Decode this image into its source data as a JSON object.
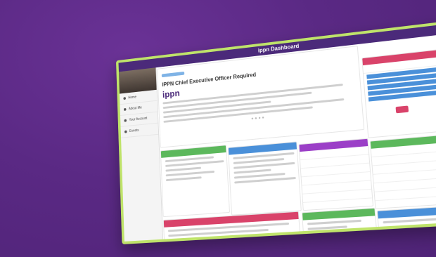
{
  "header": {
    "title": "ippn Dashboard"
  },
  "hero": {
    "title": "IPPN Chief Executive Officer Required",
    "brand": "ippn"
  },
  "sidebar": {
    "items": [
      {
        "label": "Home"
      },
      {
        "label": "About Me"
      },
      {
        "label": "Your Account"
      },
      {
        "label": "Events"
      }
    ]
  },
  "colors": {
    "frame": "#bfe36a",
    "topbar": "#4b2a7a",
    "green": "#5cb85c",
    "blue": "#4a90d9",
    "purple": "#9b3fc7",
    "pink": "#d9436a"
  },
  "cards": {
    "green1": {},
    "blue1": {},
    "purple1": {},
    "green2": {},
    "pink1": {},
    "green3": {},
    "blue2": {},
    "pink2": {}
  }
}
